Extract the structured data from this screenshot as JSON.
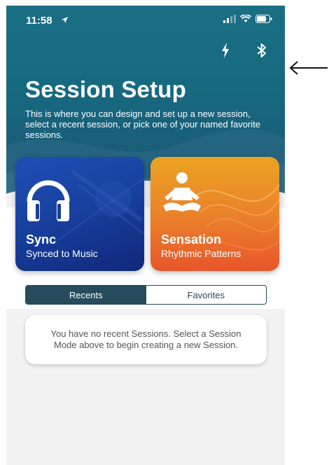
{
  "status_bar": {
    "time": "11:58"
  },
  "header": {
    "icons": [
      "lightning-icon",
      "bluetooth-icon"
    ]
  },
  "page": {
    "title": "Session Setup",
    "subtitle": "This is where you can design and set up a new session, select a recent session, or pick one of your named favorite sessions."
  },
  "modes": [
    {
      "title": "Sync",
      "subtitle": "Synced to Music",
      "icon": "headphones-icon"
    },
    {
      "title": "Sensation",
      "subtitle": "Rhythmic Patterns",
      "icon": "meditation-icon"
    }
  ],
  "tabs": [
    {
      "label": "Recents",
      "selected": true
    },
    {
      "label": "Favorites",
      "selected": false
    }
  ],
  "empty_state": {
    "message": "You have no recent Sessions. Select a Session Mode above to begin creating a new Session."
  },
  "colors": {
    "header_teal": "#166a80",
    "sync_blue": "#173f9c",
    "sensation_orange": "#ea7f2b",
    "segment_dark": "#254b5c"
  }
}
